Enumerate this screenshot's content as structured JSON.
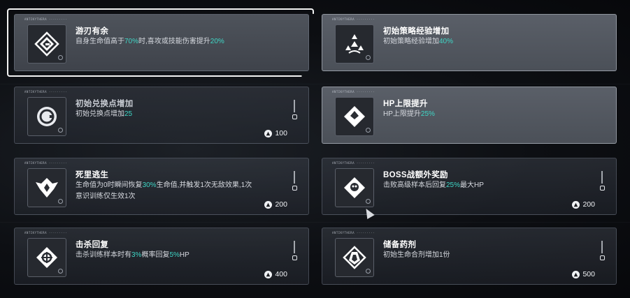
{
  "cards": [
    {
      "tag": "ANTIKYTHERA ·········",
      "title": "游刃有余",
      "desc_parts": [
        "自身生命值高于",
        "70%",
        "时,喜攻或技能伤害提升",
        "20%"
      ],
      "icon": "diamond-g-icon",
      "state": "active"
    },
    {
      "tag": "ANTIKYTHERA ·········",
      "title": "初始策略经验增加",
      "desc_parts": [
        "初始策略经验增加",
        "40%"
      ],
      "icon": "triangle-nodes-icon",
      "state": "active"
    },
    {
      "tag": "ANTIKYTHERA ·········",
      "title": "初始兑换点增加",
      "desc_parts": [
        "初始兑换点增加",
        "25"
      ],
      "icon": "coin-g-icon",
      "cost": "100",
      "state": "locked"
    },
    {
      "tag": "ANTIKYTHERA ·········",
      "title": "HP上限提升",
      "desc_parts": [
        "HP上限提升",
        "25%"
      ],
      "icon": "heart-diamond-icon",
      "state": "active"
    },
    {
      "tag": "ANTIKYTHERA ·········",
      "title": "死里逃生",
      "desc_parts": [
        "生命值为0时瞬间恢复",
        "30%",
        "生命值,并触发1次无敌效果,1次意识训练仅生效1次"
      ],
      "icon": "phoenix-icon",
      "cost": "200",
      "state": "locked"
    },
    {
      "tag": "ANTIKYTHERA ·········",
      "title": "BOSS战额外奖励",
      "desc_parts": [
        "击败高级样本后回复",
        "25%",
        "最大HP"
      ],
      "icon": "skull-icon",
      "cost": "200",
      "state": "locked"
    },
    {
      "tag": "ANTIKYTHERA ·········",
      "title": "击杀回复",
      "desc_parts": [
        "击杀训练样本时有",
        "3%",
        "概率回复",
        "5%",
        "HP"
      ],
      "icon": "target-diamond-icon",
      "cost": "400",
      "state": "locked"
    },
    {
      "tag": "ANTIKYTHERA ·········",
      "title": "储备药剂",
      "desc_parts": [
        "初始生命合剂增加1份"
      ],
      "icon": "potion-icon",
      "cost": "500",
      "state": "locked"
    }
  ],
  "colors": {
    "highlight": "#3fd6c6"
  }
}
